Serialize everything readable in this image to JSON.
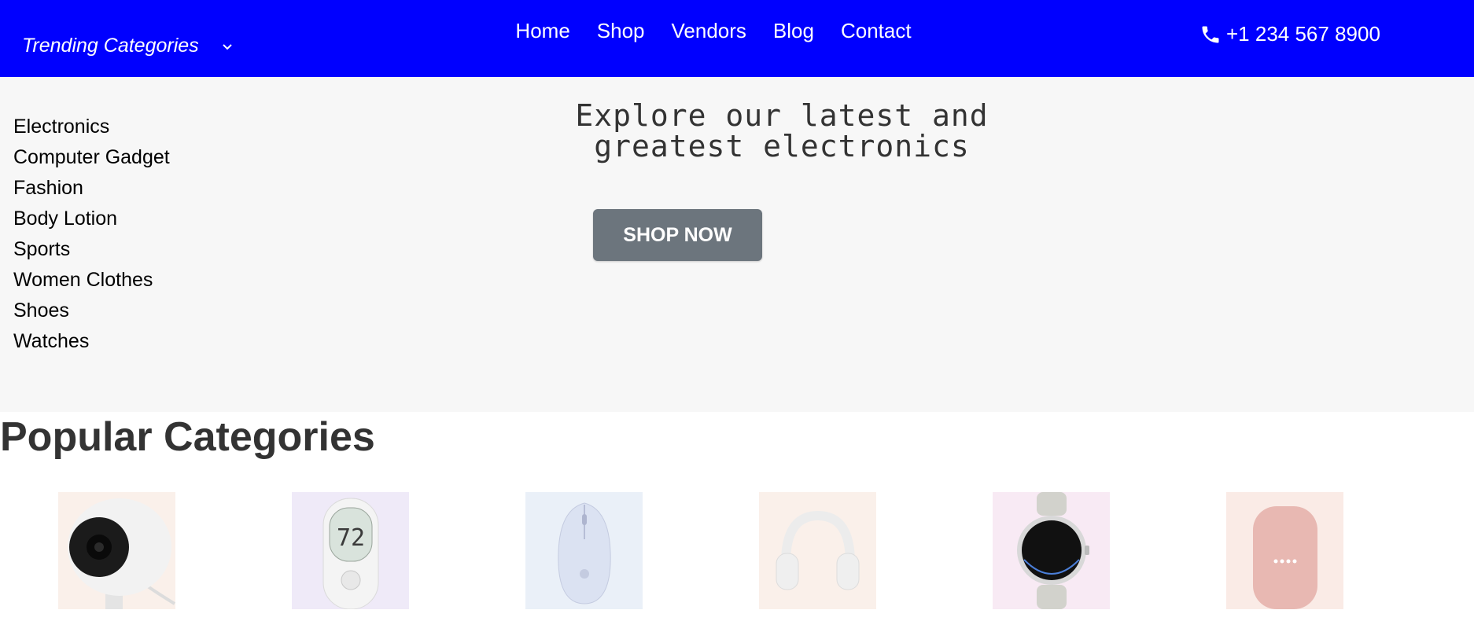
{
  "header": {
    "trending_label": "Trending Categories",
    "nav": [
      "Home",
      "Shop",
      "Vendors",
      "Blog",
      "Contact"
    ],
    "phone": "+1 234 567 8900",
    "background": "#0000ff"
  },
  "sidebar": {
    "categories": [
      "Electronics",
      "Computer Gadget",
      "Fashion",
      "Body Lotion",
      "Sports",
      "Women Clothes",
      "Shoes",
      "Watches"
    ]
  },
  "hero": {
    "title": "Explore our latest and greatest electronics",
    "cta": "SHOP NOW",
    "button_color": "#6c757d"
  },
  "popular": {
    "title": "Popular Categories",
    "items": [
      {
        "icon": "security-camera-icon",
        "bg": "#faf0ea"
      },
      {
        "icon": "thermostat-icon",
        "bg": "#efeaf8",
        "display": "72"
      },
      {
        "icon": "computer-mouse-icon",
        "bg": "#eaf0f8"
      },
      {
        "icon": "headphones-icon",
        "bg": "#faf0ea"
      },
      {
        "icon": "smartwatch-icon",
        "bg": "#f8eaf4"
      },
      {
        "icon": "smart-speaker-icon",
        "bg": "#faebe6"
      }
    ]
  }
}
